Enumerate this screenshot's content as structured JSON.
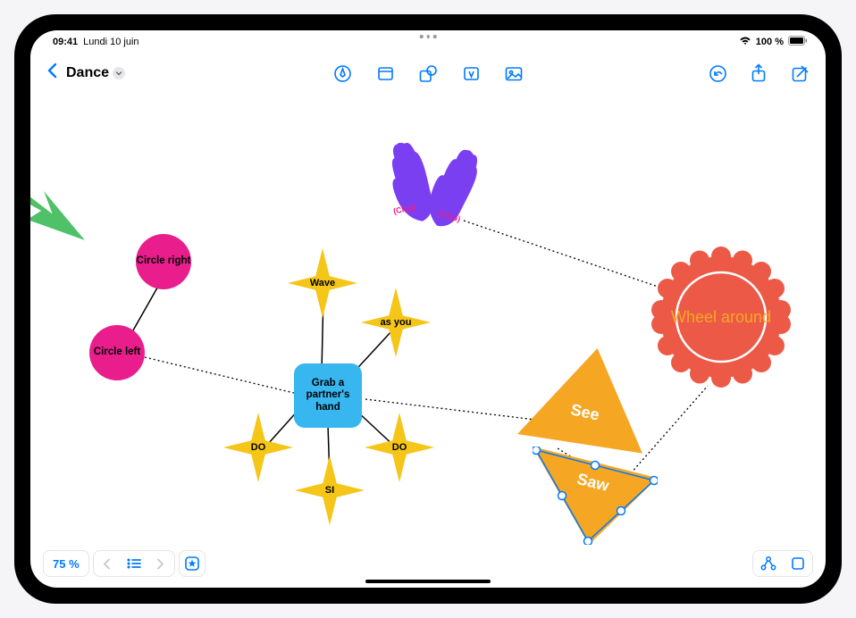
{
  "status": {
    "time": "09:41",
    "date": "Lundi 10 juin",
    "battery": "100 %"
  },
  "toolbar": {
    "board_name": "Dance"
  },
  "canvas": {
    "circle_right": "Circle right",
    "circle_left": "Circle left",
    "center": "Grab a partner's hand",
    "wave": "Wave",
    "as_you": "as you",
    "do_left": "DO",
    "do_right": "DO",
    "si": "SI",
    "see": "See",
    "saw": "Saw",
    "wheel": "Wheel around",
    "clap_left": "(Clap)",
    "clap_right": "(Clap)"
  },
  "bottom": {
    "zoom": "75 %"
  }
}
